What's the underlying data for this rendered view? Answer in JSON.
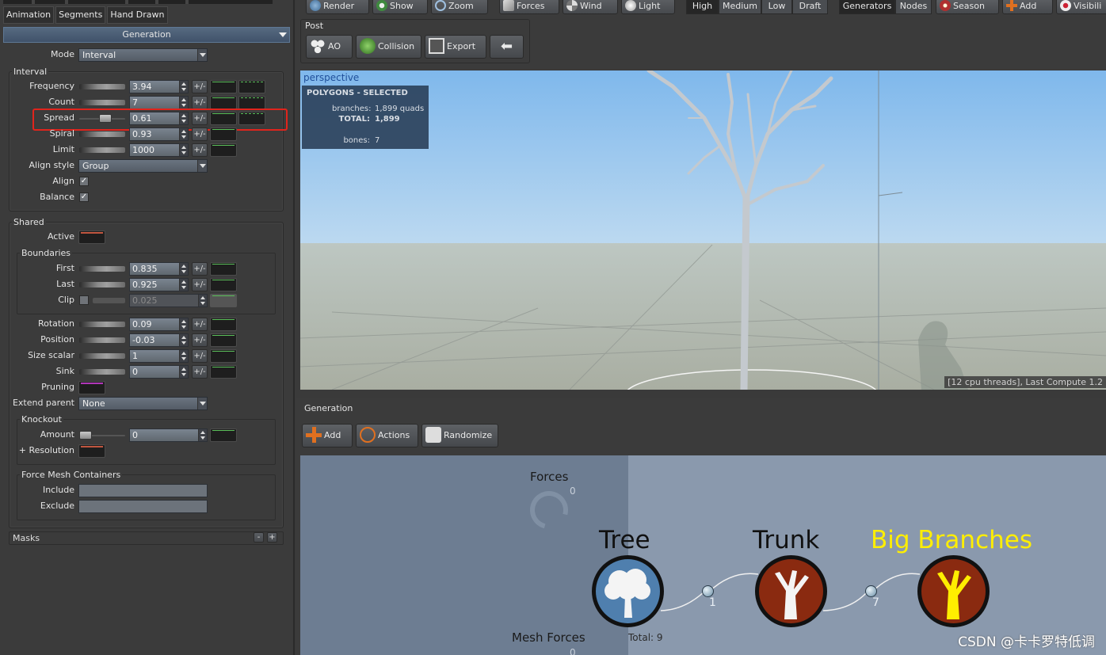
{
  "tabs": {
    "animation": "Animation",
    "segments": "Segments",
    "hand_drawn": "Hand Drawn"
  },
  "generation_header": "Generation",
  "mode": {
    "label": "Mode",
    "value": "Interval"
  },
  "interval": {
    "title": "Interval",
    "frequency": {
      "label": "Frequency",
      "value": "3.94"
    },
    "count": {
      "label": "Count",
      "value": "7"
    },
    "spread": {
      "label": "Spread",
      "value": "0.61"
    },
    "spiral": {
      "label": "Spiral",
      "value": "0.93"
    },
    "limit": {
      "label": "Limit",
      "value": "1000"
    },
    "align_style": {
      "label": "Align style",
      "value": "Group"
    },
    "align": {
      "label": "Align",
      "checked": "✓"
    },
    "balance": {
      "label": "Balance",
      "checked": "✓"
    }
  },
  "plus_minus": "+/-",
  "shared": {
    "title": "Shared",
    "active": "Active",
    "boundaries": {
      "title": "Boundaries",
      "first": {
        "label": "First",
        "value": "0.835"
      },
      "last": {
        "label": "Last",
        "value": "0.925"
      },
      "clip": {
        "label": "Clip",
        "value": "0.025"
      }
    },
    "rotation": {
      "label": "Rotation",
      "value": "0.09"
    },
    "position": {
      "label": "Position",
      "value": "-0.03"
    },
    "size_scalar": {
      "label": "Size scalar",
      "value": "1"
    },
    "sink": {
      "label": "Sink",
      "value": "0"
    },
    "pruning": "Pruning",
    "extend_parent": {
      "label": "Extend parent",
      "value": "None"
    },
    "knockout": {
      "title": "Knockout",
      "amount": {
        "label": "Amount",
        "value": "0"
      },
      "resolution": "+ Resolution"
    },
    "force_mesh": {
      "title": "Force Mesh Containers",
      "include": "Include",
      "exclude": "Exclude"
    }
  },
  "masks": {
    "label": "Masks",
    "minus": "-",
    "plus": "+"
  },
  "toolbar": {
    "render": "Render",
    "show": "Show",
    "zoom": "Zoom",
    "forces": "Forces",
    "wind": "Wind",
    "light": "Light",
    "quality": [
      "High",
      "Medium",
      "Low",
      "Draft"
    ],
    "quality_selected": "High",
    "generators": "Generators",
    "nodes": "Nodes",
    "season": "Season",
    "add": "Add",
    "visibility": "Visibili"
  },
  "post": {
    "title": "Post",
    "ao": "AO",
    "collision": "Collision",
    "export": "Export"
  },
  "viewport": {
    "camera": "perspective",
    "stats_title": "POLYGONS - SELECTED",
    "branches_label": "branches:",
    "branches_value": "1,899 quads",
    "total_label": "TOTAL:",
    "total_value": "1,899",
    "bones_label": "bones:",
    "bones_value": "7",
    "compute": "[12 cpu threads], Last Compute 1.2"
  },
  "generation_panel": {
    "title": "Generation",
    "add": "Add",
    "actions": "Actions",
    "randomize": "Randomize",
    "forces_label": "Forces",
    "forces_count": "0",
    "mesh_forces_label": "Mesh Forces",
    "mesh_forces_count": "0",
    "total": "Total: 9",
    "nodes": [
      {
        "name": "Tree"
      },
      {
        "name": "Trunk",
        "link_count": "1"
      },
      {
        "name": "Big Branches",
        "link_count": "7"
      }
    ]
  },
  "watermark": "CSDN @卡卡罗特低调",
  "colors": {
    "selected_node": "#ffee00",
    "highlight_box": "#e0241c",
    "sky_top": "#7fb8ec",
    "node_brown": "#8a2a10",
    "tree_blue": "#4f7fae"
  }
}
